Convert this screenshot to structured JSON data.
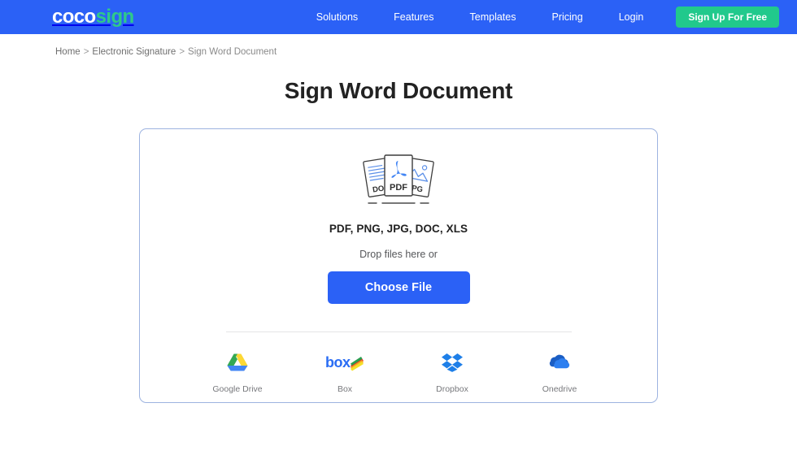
{
  "header": {
    "logo": {
      "first": "coco",
      "second": "sign",
      "color_first": "#ffffff",
      "color_second": "#2fc98a"
    },
    "background_color": "#2b61f6",
    "nav": [
      {
        "label": "Solutions"
      },
      {
        "label": "Features"
      },
      {
        "label": "Templates"
      },
      {
        "label": "Pricing"
      },
      {
        "label": "Login"
      }
    ],
    "signup_label": "Sign Up For Free",
    "signup_color": "#21c98c"
  },
  "breadcrumb": {
    "home": "Home",
    "separator": ">",
    "category": "Electronic Signature",
    "current": "Sign Word Document"
  },
  "page_title": "Sign Word Document",
  "upload": {
    "file_icon_labels": {
      "left": "DOC",
      "center": "PDF",
      "right": "JPG"
    },
    "filetypes": "PDF, PNG, JPG, DOC, XLS",
    "drop_text": "Drop files here or",
    "choose_file_label": "Choose File",
    "button_color": "#2b61f6",
    "border_color": "#9db3e0",
    "cloud_services": [
      {
        "label": "Google Drive",
        "icon": "google-drive-icon"
      },
      {
        "label": "Box",
        "icon": "box-icon"
      },
      {
        "label": "Dropbox",
        "icon": "dropbox-icon"
      },
      {
        "label": "Onedrive",
        "icon": "onedrive-icon"
      }
    ]
  }
}
